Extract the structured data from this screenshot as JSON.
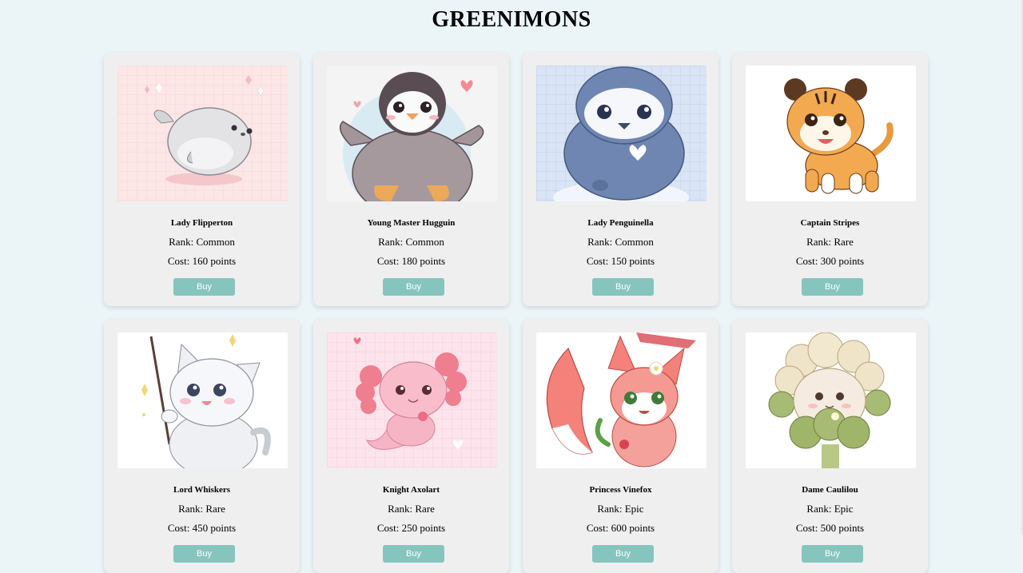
{
  "page": {
    "title": "GREENIMONS"
  },
  "cards": [
    {
      "name": "Lady Flipperton",
      "rank": "Rank: Common",
      "cost": "Cost: 160 points",
      "buy_label": "Buy",
      "image_icon": "seal-illustration"
    },
    {
      "name": "Young Master Hugguin",
      "rank": "Rank: Common",
      "cost": "Cost: 180 points",
      "buy_label": "Buy",
      "image_icon": "penguin-illustration"
    },
    {
      "name": "Lady Penguinella",
      "rank": "Rank: Common",
      "cost": "Cost: 150 points",
      "buy_label": "Buy",
      "image_icon": "blue-penguin-illustration"
    },
    {
      "name": "Captain Stripes",
      "rank": "Rank: Rare",
      "cost": "Cost: 300 points",
      "buy_label": "Buy",
      "image_icon": "tiger-illustration"
    },
    {
      "name": "Lord Whiskers",
      "rank": "Rank: Rare",
      "cost": "Cost: 450 points",
      "buy_label": "Buy",
      "image_icon": "cat-illustration"
    },
    {
      "name": "Knight Axolart",
      "rank": "Rank: Rare",
      "cost": "Cost: 250 points",
      "buy_label": "Buy",
      "image_icon": "axolotl-illustration"
    },
    {
      "name": "Princess Vinefox",
      "rank": "Rank: Epic",
      "cost": "Cost: 600 points",
      "buy_label": "Buy",
      "image_icon": "fox-illustration"
    },
    {
      "name": "Dame Caulilou",
      "rank": "Rank: Epic",
      "cost": "Cost: 500 points",
      "buy_label": "Buy",
      "image_icon": "cauliflower-illustration"
    }
  ],
  "colors": {
    "background": "#ebf5f8",
    "card": "#efefef",
    "button": "#86c5be",
    "button_text": "#ffffff"
  }
}
